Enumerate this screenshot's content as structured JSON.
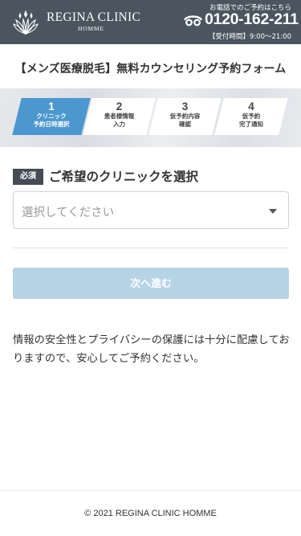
{
  "header": {
    "brand": "REGINA CLINIC",
    "brand_sub": "HOMME",
    "tel_note": "お電話でのご予約はこちら",
    "tel_number": "0120-162-211",
    "tel_hours": "【受付時間】9:00〜21:00",
    "logo_icon": "crown-leaf-logo-icon",
    "tel_icon": "free-dial-icon"
  },
  "page": {
    "title": "【メンズ医療脱毛】無料カウンセリング予約フォーム"
  },
  "steps": [
    {
      "num": "1",
      "line1": "クリニック",
      "line2": "予約日時選択",
      "active": true
    },
    {
      "num": "2",
      "line1": "患者様情報",
      "line2": "入力",
      "active": false
    },
    {
      "num": "3",
      "line1": "仮予約内容",
      "line2": "確認",
      "active": false
    },
    {
      "num": "4",
      "line1": "仮予約",
      "line2": "完了通知",
      "active": false
    }
  ],
  "form": {
    "required_badge": "必須",
    "heading": "ご希望のクリニックを選択",
    "select_placeholder": "選択してください",
    "next_button": "次へ進む"
  },
  "notice": "情報の安全性とプライバシーの保護には十分に配慮しておりますので、安心してご予約ください。",
  "footer": {
    "copyright": "© 2021 REGINA CLINIC HOMME"
  },
  "colors": {
    "header_bg": "#4a5560",
    "step_active": "#4c97cf",
    "button_disabled": "#b7d3e6",
    "badge_bg": "#454c55"
  }
}
